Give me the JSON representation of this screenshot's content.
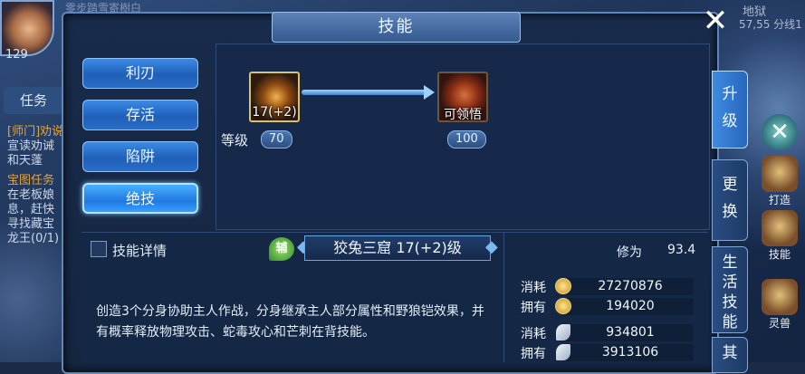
{
  "world": {
    "avatar_num": "129",
    "top_scroll": "零步踏雪寄樹白",
    "map_title": "地狱",
    "map_line": "57,55 分线1",
    "task_tab": "任务",
    "task_lines": [
      {
        "text": "[师门]劝说",
        "cls": "t1"
      },
      {
        "text": "宣读劝诫",
        "cls": "t2"
      },
      {
        "text": "和天蓬",
        "cls": "t2"
      },
      {
        "text": "宝图任务",
        "cls": "t3"
      },
      {
        "text": "在老板娘",
        "cls": "t2"
      },
      {
        "text": "息，赶快",
        "cls": "t2"
      },
      {
        "text": "寻找藏宝",
        "cls": "t2"
      },
      {
        "text": "龙王(0/1)",
        "cls": "t2"
      }
    ]
  },
  "dialog": {
    "title": "技能",
    "close_icon": "close-icon"
  },
  "categories": [
    {
      "label": "利刃",
      "active": false
    },
    {
      "label": "存活",
      "active": false
    },
    {
      "label": "陷阱",
      "active": false
    },
    {
      "label": "绝技",
      "active": true
    }
  ],
  "upgrade": {
    "level_label": "等级",
    "current": {
      "icon_text": "17(+2)",
      "level": "70"
    },
    "next": {
      "icon_text": "可领悟",
      "level": "100"
    }
  },
  "side_tabs": [
    {
      "label": "升\n级",
      "active": true
    },
    {
      "label": "更\n换",
      "active": false
    },
    {
      "label": "生\n活\n技\n能",
      "active": false
    },
    {
      "label": "其",
      "active": false
    }
  ],
  "right_shortcuts": [
    {
      "label": "打造"
    },
    {
      "label": "技能"
    },
    {
      "label": "灵兽"
    }
  ],
  "detail": {
    "checkbox_label": "技能详情",
    "aux_badge": "辅",
    "skill_name": "狡兔三窟 17(+2)级",
    "description": "创造3个分身协助主人作战，分身继承主人部分属性和野狼铠效果，并有概率释放物理攻击、蛇毒攻心和芒刺在背技能。"
  },
  "stats": {
    "cultivation_label": "修为",
    "cultivation_value": "93.4",
    "resources": [
      {
        "label": "消耗",
        "value": "27270876",
        "icon": "gold-coin-icon"
      },
      {
        "label": "拥有",
        "value": "194020",
        "icon": "gold-coin-icon"
      },
      {
        "label": "消耗",
        "value": "934801",
        "icon": "feather-icon"
      },
      {
        "label": "拥有",
        "value": "3913106",
        "icon": "feather-icon"
      }
    ]
  }
}
